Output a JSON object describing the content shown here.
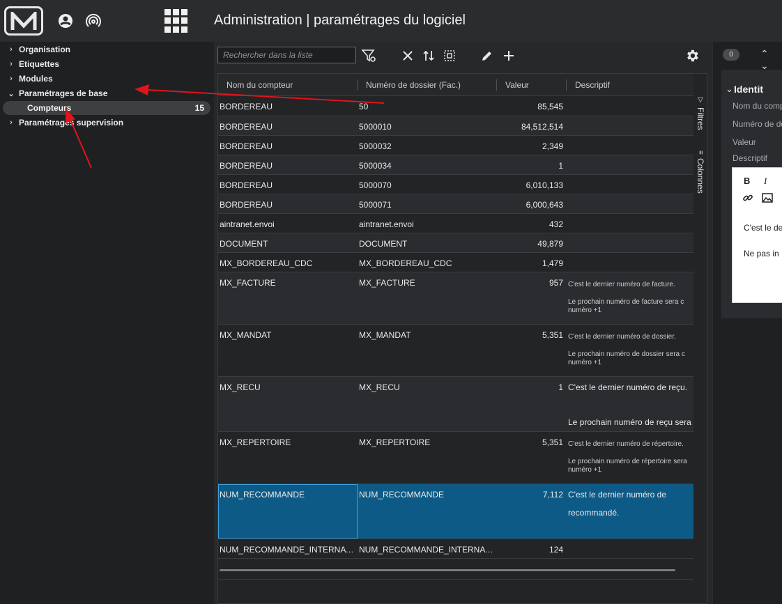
{
  "header": {
    "title": "Administration | paramétrages du logiciel"
  },
  "tree": {
    "items": [
      {
        "label": "Organisation"
      },
      {
        "label": "Etiquettes"
      },
      {
        "label": "Modules"
      },
      {
        "label": "Paramétrages de base"
      },
      {
        "label": "Compteurs",
        "count": "15"
      },
      {
        "label": "Paramétrages supervision"
      }
    ]
  },
  "toolbar": {
    "search_placeholder": "Rechercher dans la liste"
  },
  "grid": {
    "columns": [
      "Nom du compteur",
      "Numéro de dossier (Fac.)",
      "Valeur",
      "Descriptif"
    ],
    "rows": [
      {
        "nom": "BORDEREAU",
        "dossier": "50",
        "valeur": "85,545"
      },
      {
        "nom": "BORDEREAU",
        "dossier": "5000010",
        "valeur": "84,512,514"
      },
      {
        "nom": "BORDEREAU",
        "dossier": "5000032",
        "valeur": "2,349"
      },
      {
        "nom": "BORDEREAU",
        "dossier": "5000034",
        "valeur": "1"
      },
      {
        "nom": "BORDEREAU",
        "dossier": "5000070",
        "valeur": "6,010,133"
      },
      {
        "nom": "BORDEREAU",
        "dossier": "5000071",
        "valeur": "6,000,643"
      },
      {
        "nom": "aintranet.envoi",
        "dossier": "aintranet.envoi",
        "valeur": "432"
      },
      {
        "nom": "DOCUMENT",
        "dossier": "DOCUMENT",
        "valeur": "49,879"
      },
      {
        "nom": "MX_BORDEREAU_CDC",
        "dossier": "MX_BORDEREAU_CDC",
        "valeur": "1,479"
      },
      {
        "nom": "MX_FACTURE",
        "dossier": "MX_FACTURE",
        "valeur": "957",
        "desc1": "C'est le dernier numéro de facture.",
        "desc2": "Le prochain numéro de facture sera c numéro +1"
      },
      {
        "nom": "MX_MANDAT",
        "dossier": "MX_MANDAT",
        "valeur": "5,351",
        "desc1": "C'est le dernier numéro de dossier.",
        "desc2": "Le prochain numéro de dossier sera c numéro +1"
      },
      {
        "nom": "MX_RECU",
        "dossier": "MX_RECU",
        "valeur": "1",
        "desc1": "C'est le dernier numéro de reçu.",
        "desc2": "Le prochain numéro de reçu sera c"
      },
      {
        "nom": "MX_REPERTOIRE",
        "dossier": "MX_REPERTOIRE",
        "valeur": "5,351",
        "desc1": "C'est le dernier numéro de répertoire.",
        "desc2": "Le prochain numéro de répertoire sera numéro +1"
      },
      {
        "nom": "NUM_RECOMMANDE",
        "dossier": "NUM_RECOMMANDE",
        "valeur": "7,112",
        "desc1": "C'est le dernier numéro de recommandé."
      },
      {
        "nom": "NUM_RECOMMANDE_INTERNATIO...",
        "dossier": "NUM_RECOMMANDE_INTERNATIO...",
        "valeur": "124"
      }
    ],
    "side_tabs": [
      "Filtres",
      "Colonnes"
    ]
  },
  "right_panel": {
    "badge": "0",
    "section_title": "Identit",
    "fields": [
      "Nom du comp",
      "Numéro de do",
      "Valeur",
      "Descriptif"
    ],
    "editor_bold": "B",
    "editor_italic": "I",
    "editor_line1": "C'est le de",
    "editor_line2": "Ne pas in"
  },
  "colors": {
    "selected_row": "#0e5a86",
    "arrow": "#e0141b"
  }
}
